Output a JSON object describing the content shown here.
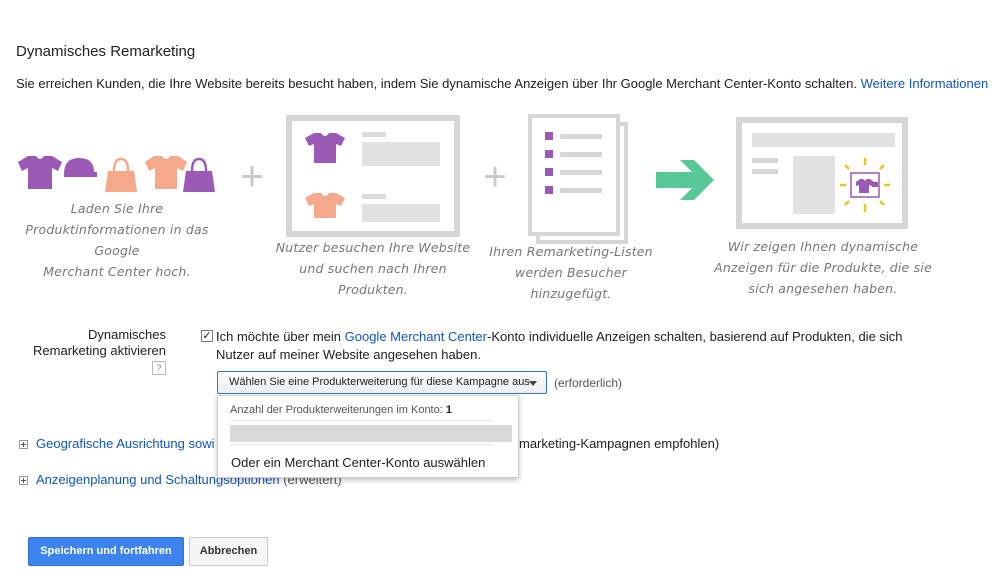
{
  "section": {
    "title": "Dynamisches Remarketing",
    "intro": "Sie erreichen Kunden, die Ihre Website bereits besucht haben, indem Sie dynamische Anzeigen über Ihr Google Merchant Center-Konto schalten.",
    "intro_link": "Weitere Informationen"
  },
  "illustration": {
    "step1_caption": [
      "Laden Sie Ihre",
      "Produktinformationen in das Google",
      "Merchant Center hoch."
    ],
    "step2_caption": [
      "Nutzer besuchen Ihre Website",
      "und suchen nach Ihren",
      "Produkten."
    ],
    "step3_caption": [
      "Ihren Remarketing-Listen",
      "werden Besucher",
      "hinzugefügt."
    ],
    "step4_caption": [
      "Wir zeigen Ihnen dynamische",
      "Anzeigen für die Produkte, die sie",
      "sich angesehen haben."
    ],
    "plus": "+",
    "colors": {
      "purple": "#9b59b6",
      "peach": "#f5a98a",
      "green": "#58c996",
      "frame": "#d6d6d6",
      "yellow": "#f2c21a"
    }
  },
  "form": {
    "field_label": "Dynamisches Remarketing aktivieren",
    "help": "?",
    "checkbox_checked": true,
    "checkbox_mark": "✓",
    "optin_prefix": "Ich möchte über mein ",
    "optin_link": "Google Merchant Center",
    "optin_suffix": "-Konto individuelle Anzeigen schalten, basierend auf Produkten, die sich Nutzer auf meiner Website angesehen haben.",
    "dropdown_label": "Wählen Sie eine Produkterweiterung für diese Kampagne aus",
    "required": "(erforderlich)",
    "menu_count_label": "Anzahl der Produkterweiterungen im Konto:",
    "menu_count_value": "1",
    "menu_alt": "Oder ein Merchant Center-Konto auswählen"
  },
  "expanders": [
    {
      "link_visible": "Geografische Ausrichtung sowi",
      "rest_visible": "marketing-Kampagnen empfohlen)"
    },
    {
      "link": "Anzeigenplanung und Schaltungsoptionen",
      "suffix": "(erweitert)"
    }
  ],
  "buttons": {
    "save": "Speichern und fortfahren",
    "cancel": "Abbrechen"
  }
}
